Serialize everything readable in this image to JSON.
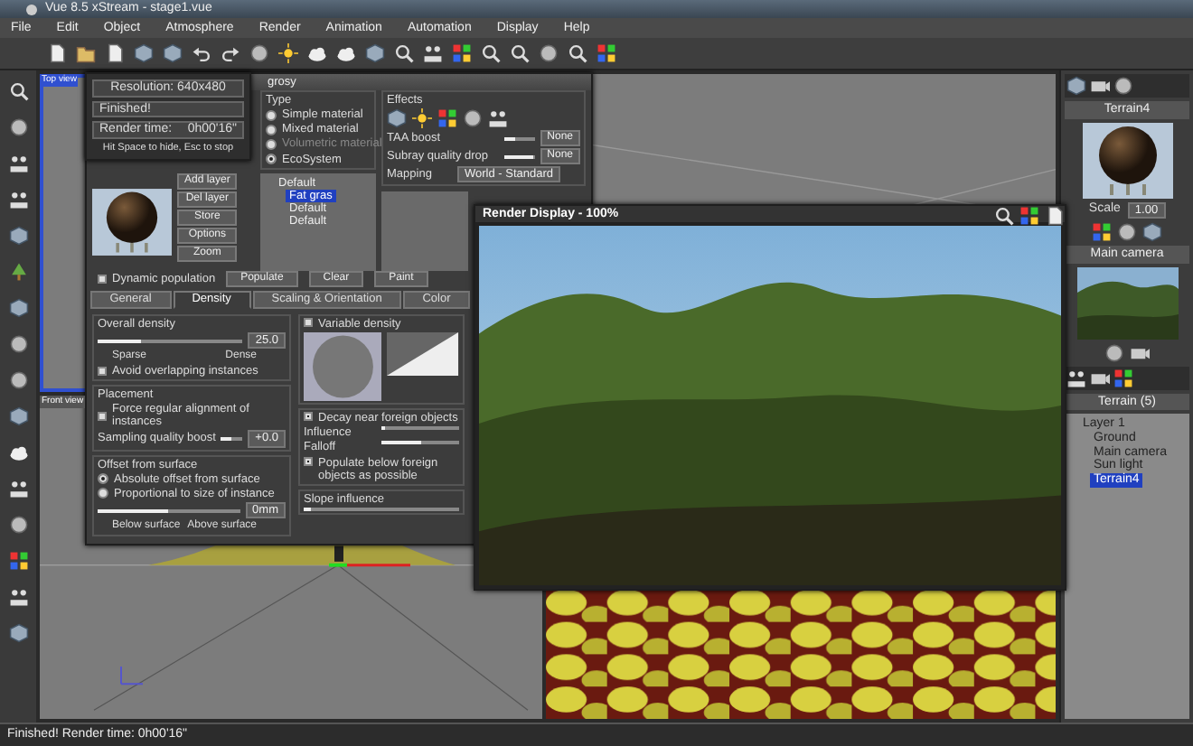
{
  "window": {
    "title": "Vue 8.5 xStream - stage1.vue"
  },
  "menu": [
    "File",
    "Edit",
    "Object",
    "Atmosphere",
    "Render",
    "Animation",
    "Automation",
    "Display",
    "Help"
  ],
  "viewports": [
    {
      "label": "Top view",
      "selected": true
    },
    {
      "label": "Front view",
      "selected": false
    }
  ],
  "render_status": {
    "resolution": "Resolution: 640x480",
    "state": "Finished!",
    "time_label": "Render time:",
    "time": "0h00'16\"",
    "hint": "Hit Space to hide, Esc to stop"
  },
  "material_editor": {
    "title": "grosy",
    "type": {
      "title": "Type",
      "options": [
        {
          "label": "Simple material",
          "selected": false,
          "disabled": false
        },
        {
          "label": "Mixed material",
          "selected": false,
          "disabled": false
        },
        {
          "label": "Volumetric material",
          "selected": false,
          "disabled": true
        },
        {
          "label": "EcoSystem",
          "selected": true,
          "disabled": false
        }
      ]
    },
    "effects": {
      "title": "Effects",
      "rows": [
        {
          "label": "TAA boost",
          "level": 0.35,
          "button": "None"
        },
        {
          "label": "Subray quality drop",
          "level": 0.95,
          "button": "None"
        }
      ],
      "mapping_label": "Mapping",
      "mapping": "World - Standard"
    },
    "layer_buttons": [
      "Add layer",
      "Del layer",
      "Store",
      "Options",
      "Zoom"
    ],
    "layers": [
      {
        "label": "Default",
        "selected": false,
        "children": [
          {
            "label": "Fat gras",
            "selected": true
          },
          {
            "label": "Default",
            "selected": false
          },
          {
            "label": "Default",
            "selected": false
          }
        ]
      }
    ],
    "dynamic_population": {
      "label": "Dynamic population",
      "checked": false
    },
    "actions": [
      "Populate",
      "Clear",
      "Paint"
    ],
    "tabs": [
      {
        "label": "General",
        "selected": false
      },
      {
        "label": "Density",
        "selected": true
      },
      {
        "label": "Scaling & Orientation",
        "selected": false
      },
      {
        "label": "Color",
        "selected": false
      }
    ],
    "overall_density": {
      "title": "Overall density",
      "level": 0.3,
      "value": "25.0",
      "min_label": "Sparse",
      "max_label": "Dense",
      "checkbox": {
        "label": "Avoid overlapping instances",
        "checked": false
      }
    },
    "placement": {
      "title": "Placement",
      "checkbox": {
        "label": "Force regular alignment of instances",
        "checked": false
      },
      "boost_label": "Sampling quality boost",
      "level": 0.5,
      "value": "+0.0"
    },
    "offset": {
      "title": "Offset from surface",
      "options": [
        {
          "label": "Absolute offset from surface",
          "selected": true
        },
        {
          "label": "Proportional to size of instance",
          "selected": false
        }
      ],
      "level": 0.5,
      "value": "0mm",
      "min_label": "Below surface",
      "max_label": "Above surface"
    },
    "variable_density": {
      "label": "Variable density",
      "checked": false
    },
    "decay": {
      "label": "Decay near foreign objects",
      "checked": true,
      "sliders": [
        {
          "label": "Influence",
          "level": 0.05
        },
        {
          "label": "Falloff",
          "level": 0.5
        }
      ],
      "checkbox": {
        "label": "Populate below foreign objects as possible",
        "checked": true
      }
    },
    "slope": {
      "title": "Slope influence",
      "level": 0.05
    }
  },
  "render_display": {
    "title": "Render Display - 100%"
  },
  "right_panel": {
    "object_title": "Terrain4",
    "scale_label": "Scale",
    "scale": "1.00",
    "camera_title": "Main camera",
    "world_title": "Terrain (5)",
    "tree": [
      {
        "label": "Layer 1",
        "selected": false,
        "children": [
          {
            "label": "Ground",
            "selected": false
          },
          {
            "label": "Main camera",
            "selected": false
          },
          {
            "label": "Sun light",
            "selected": false
          },
          {
            "label": "Terrain4",
            "selected": true
          }
        ]
      }
    ]
  },
  "status_bar": "Finished! Render time: 0h00'16\""
}
